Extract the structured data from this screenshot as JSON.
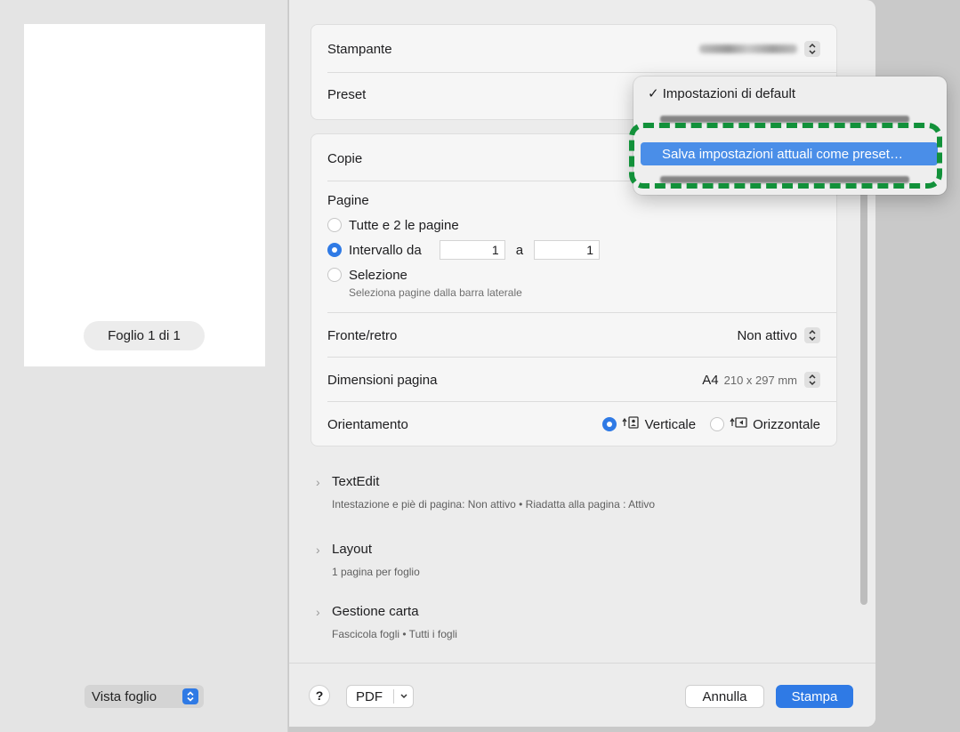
{
  "preview": {
    "sheet_label": "Foglio 1 di 1",
    "view_select": "Vista foglio"
  },
  "printer": {
    "label": "Stampante",
    "value_obscured": true
  },
  "preset": {
    "label": "Preset"
  },
  "copies": {
    "label": "Copie"
  },
  "pages": {
    "label": "Pagine",
    "option_all": "Tutte e 2 le pagine",
    "option_range": "Intervallo da",
    "range_from": "1",
    "range_sep": "a",
    "range_to": "1",
    "option_selection": "Selezione",
    "selection_hint": "Seleziona pagine dalla barra laterale"
  },
  "duplex": {
    "label": "Fronte/retro",
    "value": "Non attivo"
  },
  "paper_size": {
    "label": "Dimensioni pagina",
    "value": "A4",
    "detail": "210 x 297 mm"
  },
  "orientation": {
    "label": "Orientamento",
    "portrait": "Verticale",
    "landscape": "Orizzontale"
  },
  "sections": [
    {
      "title": "TextEdit",
      "summary": "Intestazione e piè di pagina: Non attivo • Riadatta alla pagina : Attivo"
    },
    {
      "title": "Layout",
      "summary": "1 pagina per foglio"
    },
    {
      "title": "Gestione carta",
      "summary": "Fascicola fogli • Tutti i fogli"
    }
  ],
  "footer": {
    "help": "?",
    "pdf": "PDF",
    "cancel": "Annulla",
    "print": "Stampa"
  },
  "preset_menu": {
    "default_item": "✓ Impostazioni di default",
    "save_item": "Salva impostazioni attuali come preset…"
  },
  "colors": {
    "accent": "#2f7ae5",
    "highlight": "#4a8ee8",
    "annotation": "#12913a"
  }
}
